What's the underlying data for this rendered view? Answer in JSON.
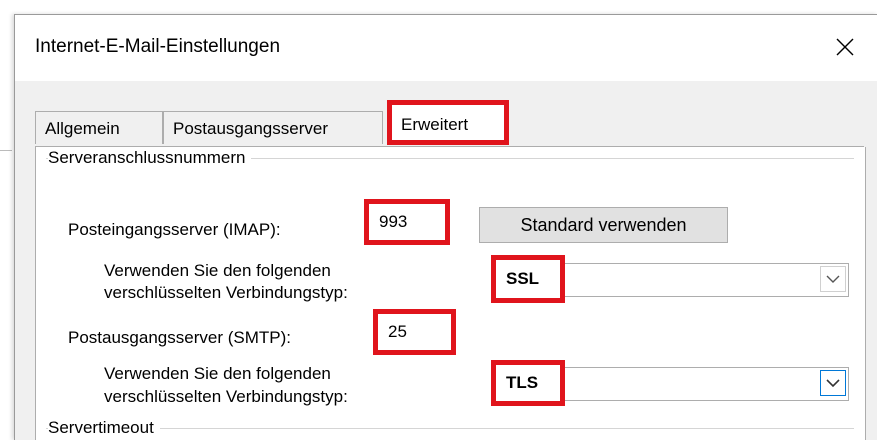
{
  "dialog": {
    "title": "Internet-E-Mail-Einstellungen",
    "close_label": "Schließen"
  },
  "tabs": [
    {
      "label": "Allgemein",
      "active": false
    },
    {
      "label": "Postausgangsserver",
      "active": false
    },
    {
      "label": "Erweitert",
      "active": true
    }
  ],
  "server_ports": {
    "group_label": "Serveranschlussnummern",
    "incoming_label": "Posteingangsserver (IMAP):",
    "incoming_value": "993",
    "default_button": "Standard verwenden",
    "encryption_label_line1": "Verwenden Sie den folgenden",
    "encryption_label_line2": "verschlüsselten Verbindungstyp:",
    "incoming_encryption": "SSL",
    "outgoing_label": "Postausgangsserver (SMTP):",
    "outgoing_value": "25",
    "outgoing_encryption": "TLS"
  },
  "server_timeout": {
    "group_label": "Servertimeout"
  },
  "colors": {
    "highlight": "#e0141c",
    "dialog_bg": "#f0f0f0",
    "focus": "#0078d7"
  }
}
